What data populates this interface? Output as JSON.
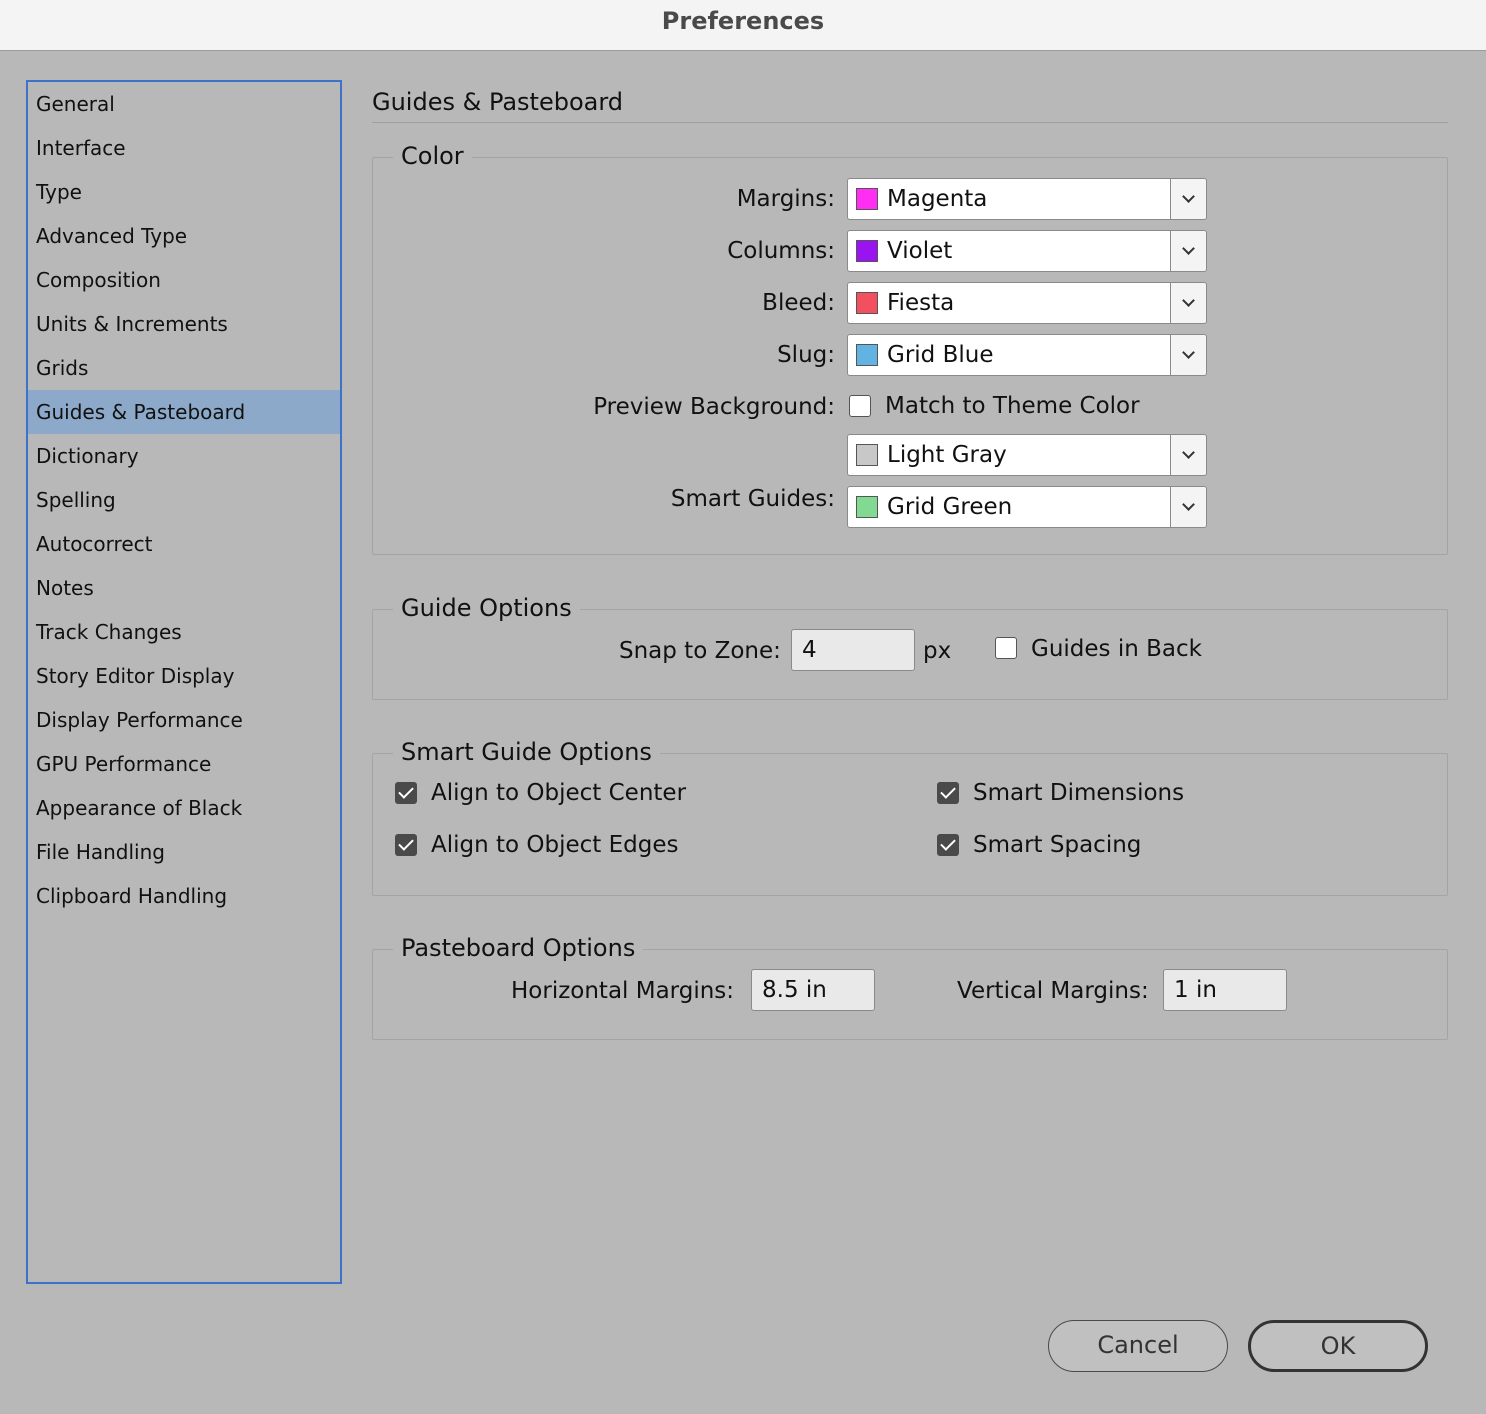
{
  "window": {
    "title": "Preferences"
  },
  "sidebar": {
    "items": [
      {
        "label": "General"
      },
      {
        "label": "Interface"
      },
      {
        "label": "Type"
      },
      {
        "label": "Advanced Type"
      },
      {
        "label": "Composition"
      },
      {
        "label": "Units & Increments"
      },
      {
        "label": "Grids"
      },
      {
        "label": "Guides & Pasteboard",
        "selected": true
      },
      {
        "label": "Dictionary"
      },
      {
        "label": "Spelling"
      },
      {
        "label": "Autocorrect"
      },
      {
        "label": "Notes"
      },
      {
        "label": "Track Changes"
      },
      {
        "label": "Story Editor Display"
      },
      {
        "label": "Display Performance"
      },
      {
        "label": "GPU Performance"
      },
      {
        "label": "Appearance of Black"
      },
      {
        "label": "File Handling"
      },
      {
        "label": "Clipboard Handling"
      }
    ]
  },
  "main": {
    "title": "Guides & Pasteboard"
  },
  "color": {
    "title": "Color",
    "margins": {
      "label": "Margins:",
      "value": "Magenta",
      "swatch": "#ff2ef2"
    },
    "columns": {
      "label": "Columns:",
      "value": "Violet",
      "swatch": "#9a14f2"
    },
    "bleed": {
      "label": "Bleed:",
      "value": "Fiesta",
      "swatch": "#f25060"
    },
    "slug": {
      "label": "Slug:",
      "value": "Grid Blue",
      "swatch": "#62b2e2"
    },
    "preview_background": {
      "label": "Preview Background:",
      "match_label": "Match to Theme Color",
      "match_checked": false,
      "value": "Light Gray",
      "swatch": "#c8c8c8"
    },
    "smart_guides": {
      "label": "Smart Guides:",
      "value": "Grid Green",
      "swatch": "#82d992"
    }
  },
  "guide_options": {
    "title": "Guide Options",
    "snap_label": "Snap to Zone:",
    "snap_value": "4",
    "snap_unit": "px",
    "guides_in_back_label": "Guides in Back",
    "guides_in_back_checked": false
  },
  "smart_guide_options": {
    "title": "Smart Guide Options",
    "align_center": {
      "label": "Align to Object Center",
      "checked": true
    },
    "align_edges": {
      "label": "Align to Object Edges",
      "checked": true
    },
    "smart_dimensions": {
      "label": "Smart Dimensions",
      "checked": true
    },
    "smart_spacing": {
      "label": "Smart Spacing",
      "checked": true
    }
  },
  "pasteboard_options": {
    "title": "Pasteboard Options",
    "horizontal_label": "Horizontal Margins:",
    "horizontal_value": "8.5 in",
    "vertical_label": "Vertical Margins:",
    "vertical_value": "1 in"
  },
  "buttons": {
    "cancel": "Cancel",
    "ok": "OK"
  }
}
